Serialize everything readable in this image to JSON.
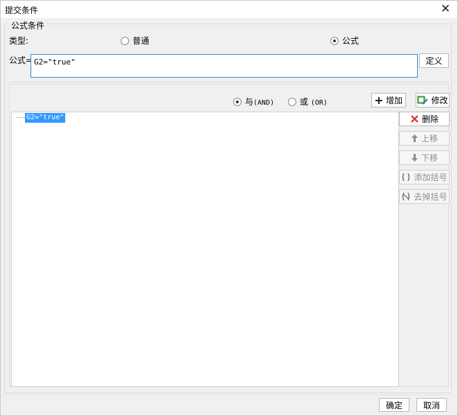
{
  "window": {
    "title": "提交条件",
    "close_glyph": "✕"
  },
  "group": {
    "legend": "公式条件"
  },
  "type_row": {
    "label": "类型:",
    "options": [
      {
        "label": "普通",
        "checked": false
      },
      {
        "label": "公式",
        "checked": true
      }
    ]
  },
  "formula": {
    "label": "公式=",
    "value": "G2=\"true\"",
    "define_button": "定义"
  },
  "logic": {
    "and": {
      "label": "与",
      "code": "(AND)",
      "checked": true
    },
    "or": {
      "label": "或",
      "code": "(OR)",
      "checked": false
    }
  },
  "actions": {
    "add": "增加",
    "modify": "修改",
    "delete": "删除",
    "move_up": "上移",
    "move_down": "下移",
    "add_bracket": "添加括号",
    "remove_bracket": "去掉括号"
  },
  "conditions": [
    {
      "text": "G2=\"true\"",
      "selected": true
    }
  ],
  "footer": {
    "ok": "确定",
    "cancel": "取消"
  },
  "colors": {
    "selection": "#3399ff",
    "focus_border": "#3c7fd0",
    "delete_icon": "#e03c3c",
    "modify_icon": "#3a9a3a"
  }
}
